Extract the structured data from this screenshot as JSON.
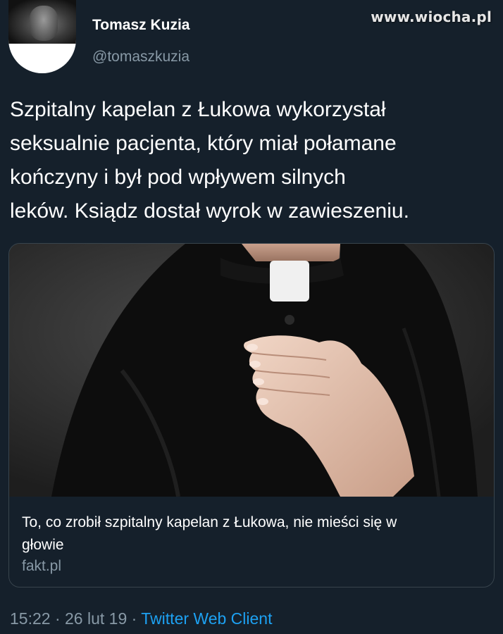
{
  "watermark": "www.wiocha.pl",
  "author": {
    "name": "Tomasz Kuzia",
    "handle": "@tomaszkuzia"
  },
  "tweet": {
    "text": "Szpitalny kapelan z Łukowa wykorzystał\nseksualnie pacjenta, który miał połamane\nkończyny i był pod wpływem silnych\nleków. Ksiądz dostał wyrok w zawieszeniu."
  },
  "card": {
    "title": "To, co zrobił szpitalny kapelan z Łukowa, nie mieści się w głowie",
    "domain": "fakt.pl"
  },
  "footer": {
    "time": "15:22",
    "separator": " · ",
    "date": "26 lut 19",
    "client": "Twitter Web Client"
  },
  "colors": {
    "background": "#15202b",
    "secondary_text": "#8899a6",
    "link": "#1da1f2",
    "card_border": "#38444d"
  }
}
